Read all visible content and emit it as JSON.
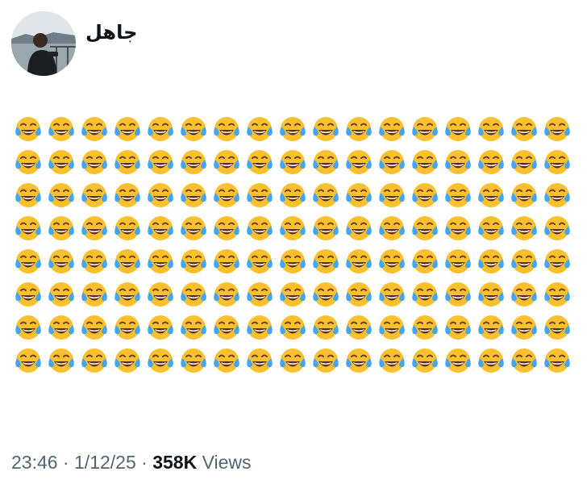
{
  "post": {
    "author_name": "جاهل",
    "content": {
      "emoji": "😂",
      "emoji_name": "face-with-tears-of-joy",
      "rows": 8,
      "columns": 17
    },
    "footer": {
      "time": "23:46",
      "separator": "·",
      "date": "1/12/25",
      "view_count": "358K",
      "views_label": "Views"
    }
  },
  "colors": {
    "emoji_face": "#fbc02d",
    "emoji_tears": "#42a5f5",
    "text_primary": "#0f1419",
    "text_secondary": "#536471"
  }
}
